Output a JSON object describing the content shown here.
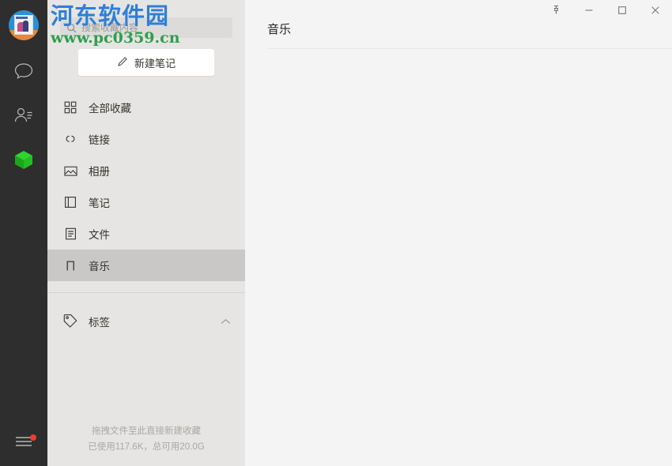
{
  "window": {
    "controls": [
      {
        "name": "pin",
        "label": "固定",
        "glyph": "pin"
      },
      {
        "name": "minimize",
        "label": "最小化",
        "glyph": "minimize"
      },
      {
        "name": "maximize",
        "label": "最大化",
        "glyph": "maximize"
      },
      {
        "name": "close",
        "label": "关闭",
        "glyph": "close"
      }
    ]
  },
  "rail": {
    "avatar_name": "user-avatar",
    "items": [
      {
        "name": "chat",
        "icon": "chat-bubble-icon",
        "active": false
      },
      {
        "name": "contacts",
        "icon": "contacts-icon",
        "active": false
      },
      {
        "name": "favorites",
        "icon": "green-cube-icon",
        "active": true
      }
    ],
    "menu": {
      "icon": "hamburger-menu-icon",
      "has_badge": true
    }
  },
  "search": {
    "placeholder": "搜索收藏内容",
    "value": "",
    "icon": "search-icon"
  },
  "new_note": {
    "label": "新建笔记",
    "icon": "pencil-icon"
  },
  "sidebar": {
    "items": [
      {
        "label": "全部收藏",
        "icon": "grid-icon",
        "selected": false
      },
      {
        "label": "链接",
        "icon": "link-icon",
        "selected": false
      },
      {
        "label": "相册",
        "icon": "image-icon",
        "selected": false
      },
      {
        "label": "笔记",
        "icon": "book-icon",
        "selected": false
      },
      {
        "label": "文件",
        "icon": "document-icon",
        "selected": false
      },
      {
        "label": "音乐",
        "icon": "music-note-icon",
        "selected": true
      }
    ],
    "tags": {
      "label": "标签",
      "icon": "tag-icon",
      "chevron": "chevron-up-icon",
      "expanded": true
    },
    "footer": {
      "drop_hint": "拖拽文件至此直接新建收藏",
      "storage": "已使用117.6K，总可用20.0G"
    }
  },
  "main": {
    "title": "音乐"
  },
  "watermark": {
    "title": "河东软件园",
    "url": "www.pc0359.cn",
    "title_color": "#2f7fd6",
    "url_color": "#2f9e4f"
  },
  "colors": {
    "rail_bg": "#2e2e2e",
    "sidebar_bg": "#e6e5e3",
    "selected_bg": "#c9c8c6",
    "main_bg": "#f4f4f4",
    "accent_green": "#22c222",
    "badge_red": "#f03c2e"
  }
}
